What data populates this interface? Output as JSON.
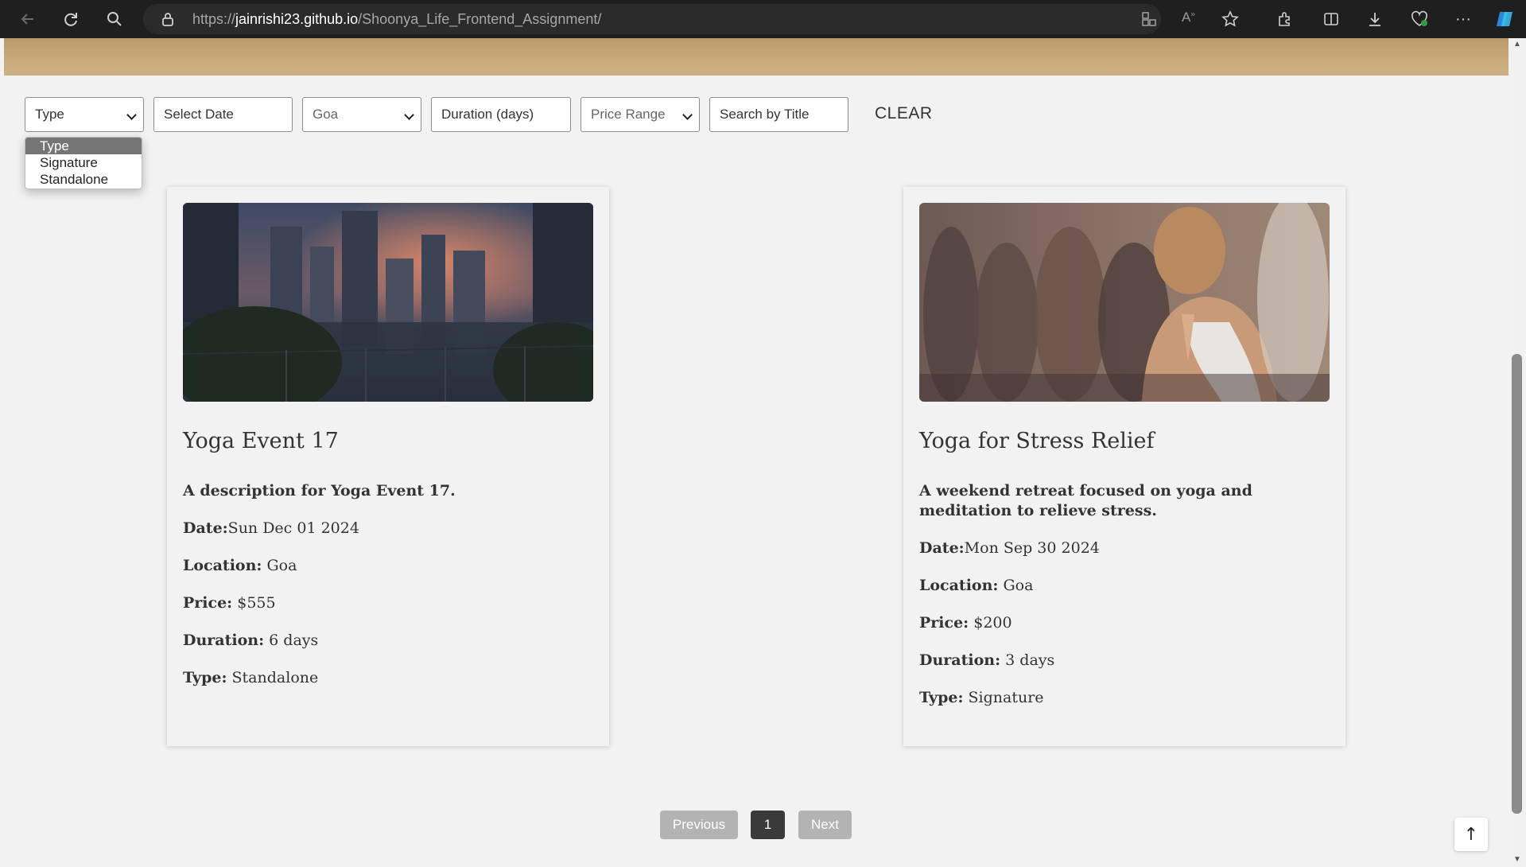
{
  "browser": {
    "url_prefix": "https://",
    "url_host": "jainrishi23.github.io",
    "url_path": "/Shoonya_Life_Frontend_Assignment/"
  },
  "filters": {
    "type_label": "Type",
    "date_placeholder": "Select Date",
    "location_value": "Goa",
    "duration_placeholder": "Duration (days)",
    "price_label": "Price Range",
    "search_placeholder": "Search by Title",
    "clear_label": "CLEAR"
  },
  "type_dropdown": {
    "options": [
      "Type",
      "Signature",
      "Standalone"
    ],
    "selected": "Type"
  },
  "cards": [
    {
      "title": "Yoga Event 17",
      "description": "A description for Yoga Event 17.",
      "date_label": "Date:",
      "date": "Sun Dec 01 2024",
      "location_label": "Location:",
      "location": "Goa",
      "price_label": "Price:",
      "price": "$555",
      "duration_label": "Duration:",
      "duration": "6 days",
      "type_label": "Type:",
      "type": "Standalone"
    },
    {
      "title": "Yoga for Stress Relief",
      "description": "A weekend retreat focused on yoga and meditation to relieve stress.",
      "date_label": "Date:",
      "date": "Mon Sep 30 2024",
      "location_label": "Location:",
      "location": "Goa",
      "price_label": "Price:",
      "price": "$200",
      "duration_label": "Duration:",
      "duration": "3 days",
      "type_label": "Type:",
      "type": "Signature"
    }
  ],
  "pagination": {
    "previous_label": "Previous",
    "current_page": "1",
    "next_label": "Next"
  },
  "scroll_top_label": "↑",
  "colors": {
    "page_bg": "#f3f2f2",
    "active_page": "#3a3a3a",
    "disabled_button": "#b3b3b3",
    "dropdown_selected": "#757575"
  }
}
